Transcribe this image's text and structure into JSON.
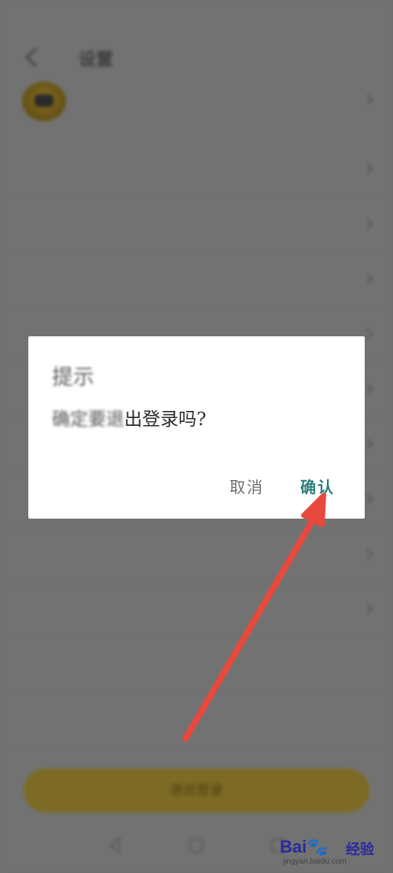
{
  "status_bar": {
    "left_text": "",
    "right_text": ""
  },
  "header": {
    "title": "设置"
  },
  "account": {
    "name": "",
    "subtitle": ""
  },
  "settings_rows": [
    {
      "label": "",
      "value": ""
    },
    {
      "label": "",
      "value": ""
    },
    {
      "label": "",
      "value": ""
    },
    {
      "label": "",
      "value": ""
    },
    {
      "label": "",
      "value": ""
    },
    {
      "label": "",
      "value": ""
    },
    {
      "label": "",
      "value": ""
    },
    {
      "label": "",
      "value": ""
    },
    {
      "label": "",
      "value": ""
    },
    {
      "label": "",
      "value": ""
    },
    {
      "label": "",
      "value": ""
    }
  ],
  "logout_button": {
    "label": "退出登录"
  },
  "dialog": {
    "title": "提示",
    "message_blurred": "确定要退",
    "message_clear": "出登录吗?",
    "cancel_label": "取消",
    "confirm_label": "确认"
  },
  "watermark": {
    "logo_text": "Bai",
    "logo_paw": "🐾",
    "logo_cn": "经验",
    "url": "jingyan.baidu.com"
  },
  "colors": {
    "dialog_background": "#ffffff",
    "confirm_accent": "#2d7f78",
    "overlay": "#727272",
    "annotation_arrow": "#e8493c",
    "logout_button": "#7d6a25"
  }
}
